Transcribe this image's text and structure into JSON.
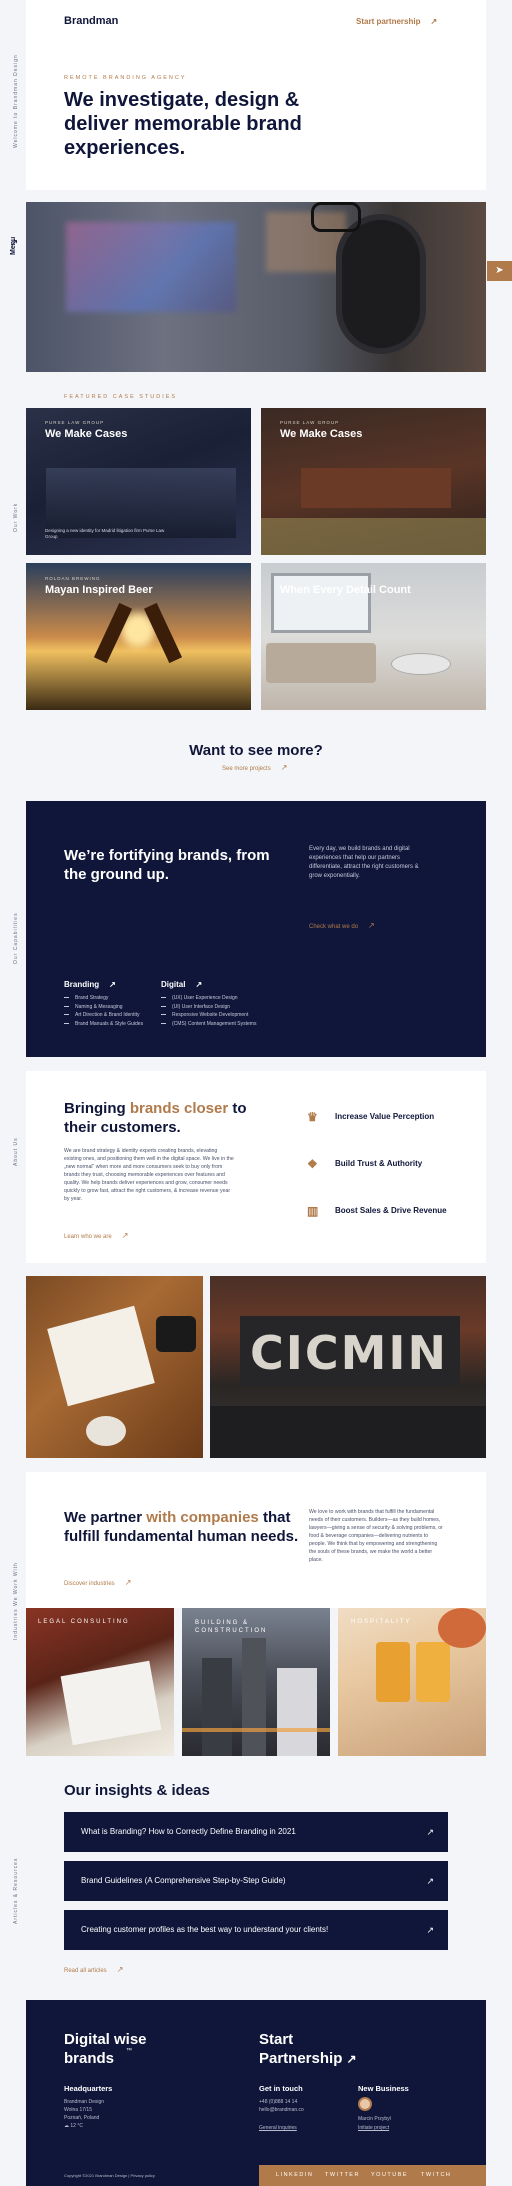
{
  "header": {
    "logo": "Brandman",
    "start_partnership": "Start partnership",
    "arrow": "↗"
  },
  "rail": {
    "welcome": "Welcome to Brandman Design",
    "menu": "Menu",
    "our_work": "Our Work",
    "capabilities": "Our Capabilities",
    "about": "About Us",
    "industries": "Industries We Work With",
    "articles": "Articles & Resources"
  },
  "hero": {
    "eyebrow": "REMOTE BRANDING AGENCY",
    "title": "We investigate, design & deliver memorable brand experiences."
  },
  "cases": {
    "eyebrow": "FEATURED CASE STUDIES",
    "items": [
      {
        "eyebrow": "PURSE LAW GROUP",
        "title": "We Make Cases",
        "desc": "Designing a new identity for Madrid litigation firm Purse Law Group"
      },
      {
        "eyebrow": "PURSE LAW GROUP",
        "title": "We Make Cases",
        "desc": ""
      },
      {
        "eyebrow": "ROLDAN BREWING",
        "title": "Mayan Inspired Beer",
        "desc": ""
      },
      {
        "eyebrow": "",
        "title": "When Every Detail Count",
        "desc": ""
      }
    ]
  },
  "more": {
    "title": "Want to see more?",
    "link": "See more projects"
  },
  "capabilities": {
    "title": "We’re fortifying brands, from the ground up.",
    "text": "Every day, we build brands and digital experiences that help our partners differentiate, attract the right customers & grow exponentially.",
    "link": "Check what we do",
    "branding": {
      "title": "Branding",
      "items": [
        "Brand Strategy",
        "Naming & Messaging",
        "Art Direction & Brand Identity",
        "Brand Manuals & Style Guides"
      ]
    },
    "digital": {
      "title": "Digital",
      "items": [
        "(UX) User Experience Design",
        "(UI) User Interface Design",
        "Responsive Website Development",
        "(CMS) Content Management Systems"
      ]
    }
  },
  "about": {
    "title_prefix": "Bringing ",
    "title_highlight": "brands closer",
    "title_suffix": " to their customers.",
    "text": "We are brand strategy & identity experts creating brands, elevating existing ones, and positioning them well in the digital space. We live in the „new normal“ when more and more consumers seek to buy only from brands they trust, choosing memorable experiences over features and quality. We help brands deliver experiences and grow, consumer needs quickly to grow fast, attract the right customers, & increase revenue year by year.",
    "link": "Learn who we are",
    "features": [
      "Increase Value Perception",
      "Build Trust & Authority",
      "Boost Sales & Drive Revenue"
    ]
  },
  "industries": {
    "title_prefix": "We partner ",
    "title_highlight": "with companies",
    "title_suffix": " that fulfill fundamental human needs.",
    "text": "We love to work with brands that fulfill the fundamental needs of their customers. Builders—as they build homes, lawyers—giving a sense of security & solving problems, or food & beverage companies—delivering nutrients to people. We think that by empowering and strengthening the souls of these brands, we make the world a better place.",
    "link": "Discover industries",
    "labels": [
      "LEGAL CONSULTING",
      "BUILDING & CONSTRUCTION",
      "HOSPITALITY"
    ]
  },
  "insights": {
    "title": "Our insights & ideas",
    "articles": [
      "What is Branding? How to Correctly Define Branding in 2021",
      "Brand Guidelines (A Comprehensive Step-by-Step Guide)",
      "Creating customer profiles as the best way to understand your clients!"
    ],
    "link": "Read all articles"
  },
  "footer": {
    "left_title": "Digital wise brands",
    "tm": "™",
    "right_title": "Start Partnership",
    "hq_title": "Headquarters",
    "hq_lines": [
      "Brandman Design",
      "Wolna 17/15",
      "Poznań, Poland",
      "12 °C"
    ],
    "touch_title": "Get in touch",
    "touch_lines": [
      "+48 (0)888 14 14",
      "hello@brandman.co"
    ],
    "general": "General inquiries",
    "biz_title": "New Business",
    "biz_name": "Marcin Przybył",
    "biz_link": "Initiate project",
    "copyright": "Copyright ©2021 Brandman Design | Privacy policy",
    "socials": [
      "LINKEDIN",
      "TWITTER",
      "YOUTUBE",
      "TWITCH"
    ]
  }
}
